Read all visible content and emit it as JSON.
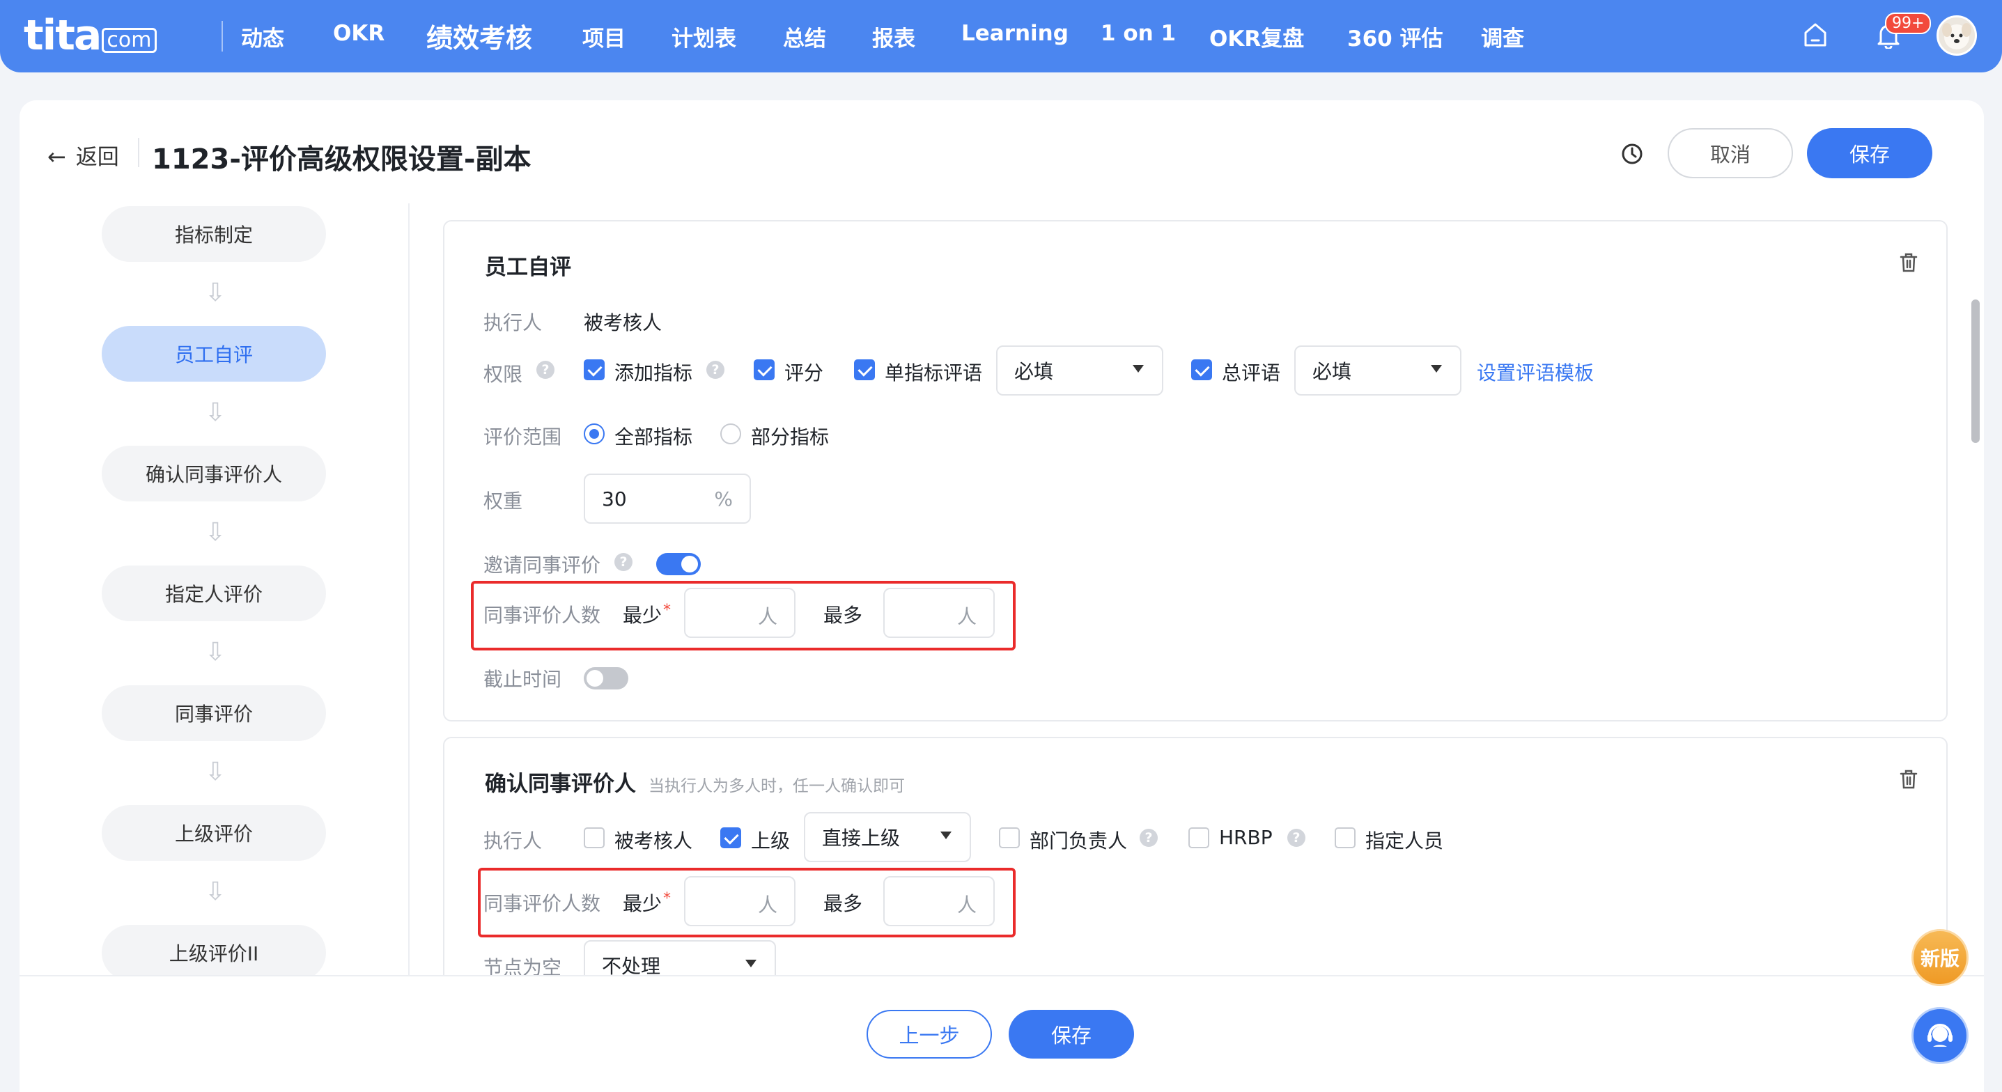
{
  "app": {
    "logo": "tita",
    "logo_suffix": "com"
  },
  "nav": {
    "items": [
      "动态",
      "OKR",
      "绩效考核",
      "项目",
      "计划表",
      "总结",
      "报表",
      "Learning",
      "1 on 1",
      "OKR复盘",
      "360 评估",
      "调查"
    ],
    "active": "绩效考核",
    "notification_badge": "99+"
  },
  "header": {
    "back_label": "返回",
    "title": "1123-评价高级权限设置-副本",
    "cancel_label": "取消",
    "save_label": "保存"
  },
  "steps": [
    "指标制定",
    "员工自评",
    "确认同事评价人",
    "指定人评价",
    "同事评价",
    "上级评价",
    "上级评价II"
  ],
  "active_step": "员工自评",
  "section1": {
    "title": "员工自评",
    "executor_label": "执行人",
    "executor_value": "被考核人",
    "permission_label": "权限",
    "perm_add_indicator": "添加指标",
    "perm_score": "评分",
    "perm_single_comment": "单指标评语",
    "single_comment_select": "必填",
    "perm_total_comment": "总评语",
    "total_comment_select": "必填",
    "template_link": "设置评语模板",
    "scope_label": "评价范围",
    "scope_all": "全部指标",
    "scope_partial": "部分指标",
    "weight_label": "权重",
    "weight_value": "30",
    "weight_unit": "%",
    "invite_label": "邀请同事评价",
    "peer_count_label": "同事评价人数",
    "min_label": "最少",
    "max_label": "最多",
    "person_unit": "人",
    "deadline_label": "截止时间"
  },
  "section2": {
    "title": "确认同事评价人",
    "subtitle": "当执行人为多人时，任一人确认即可",
    "executor_label": "执行人",
    "opt_assessee": "被考核人",
    "opt_superior": "上级",
    "superior_select": "直接上级",
    "opt_dept_head": "部门负责人",
    "opt_hrbp": "HRBP",
    "opt_designated": "指定人员",
    "peer_count_label": "同事评价人数",
    "min_label": "最少",
    "max_label": "最多",
    "person_unit": "人",
    "empty_node_label": "节点为空",
    "empty_node_select": "不处理"
  },
  "footer": {
    "prev_label": "上一步",
    "save_label": "保存"
  },
  "floating": {
    "new_version": "新版"
  },
  "colors": {
    "primary": "#3a78f2",
    "nav_bg": "#4b86f0",
    "highlight_box": "#ea2b2b"
  }
}
